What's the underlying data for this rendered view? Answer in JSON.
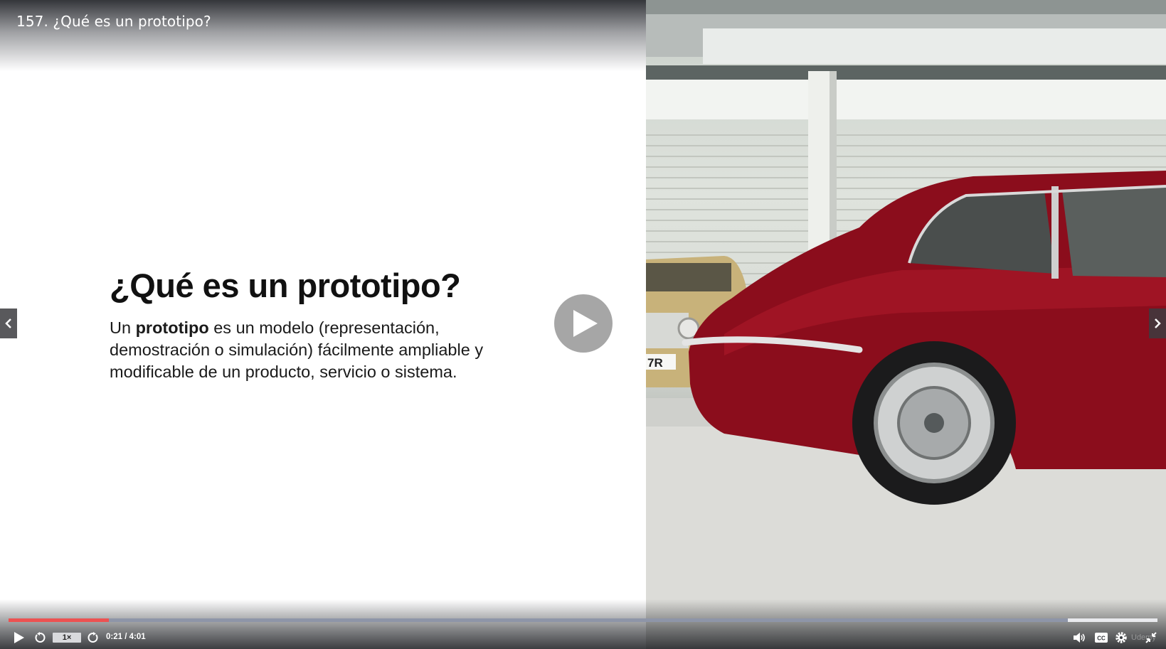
{
  "header": {
    "title": "157. ¿Qué es un prototipo?"
  },
  "slide": {
    "heading": "¿Qué es un prototipo?",
    "body_prefix": "Un ",
    "body_bold": "prototipo",
    "body_suffix": " es un modelo (representación, demostración o simulación) fácilmente ampliable y modificable de un producto, servicio o sistema."
  },
  "photo": {
    "plate_fragment": "7R"
  },
  "player": {
    "big_play_icon": "play-icon",
    "prev_icon": "chevron-left-icon",
    "next_icon": "chevron-right-icon",
    "progress": 0.087,
    "speed": "1×",
    "current_time": "0:21",
    "duration": "4:01",
    "time_display": "0:21 / 4:01",
    "watermark": "Udemy",
    "accent_color": "#ec5252",
    "icons": [
      "play-icon",
      "rewind-icon",
      "forward-icon",
      "volume-icon",
      "captions-icon",
      "settings-icon",
      "exit-fullscreen-icon"
    ]
  }
}
